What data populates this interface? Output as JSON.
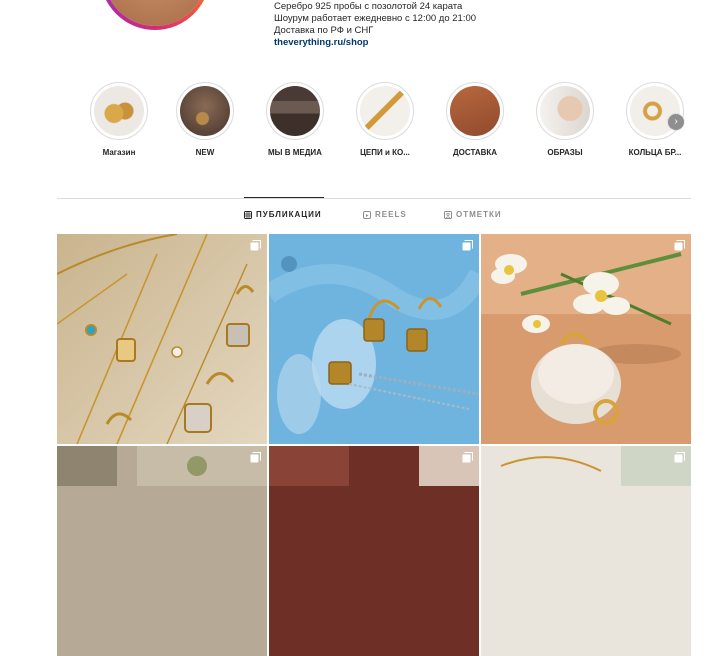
{
  "profile": {
    "bio_lines": [
      "Серебро 925 пробы с позолотой 24 карата",
      "Шоурум работает ежедневно с 12:00 до 21:00",
      "Доставка по РФ и СНГ"
    ],
    "link": "theverything.ru/shop"
  },
  "highlights": [
    {
      "label": "Магазин",
      "icon": "gold-earrings-thumbnail"
    },
    {
      "label": "NEW",
      "icon": "earrings-portrait-thumbnail"
    },
    {
      "label": "МЫ В МЕДИА",
      "icon": "media-story-thumbnail"
    },
    {
      "label": "ЦЕПИ и КО...",
      "icon": "gold-chain-thumbnail"
    },
    {
      "label": "ДОСТАВКА",
      "icon": "package-box-thumbnail"
    },
    {
      "label": "ОБРАЗЫ",
      "icon": "model-look-thumbnail"
    },
    {
      "label": "КОЛЬЦА БР...",
      "icon": "gold-ring-thumbnail"
    }
  ],
  "tabs": [
    {
      "label": "ПУБЛИКАЦИИ",
      "icon": "grid-icon",
      "active": true
    },
    {
      "label": "REELS",
      "icon": "reels-icon",
      "active": false
    },
    {
      "label": "ОТМЕТКИ",
      "icon": "tagged-icon",
      "active": false
    }
  ],
  "posts": [
    {
      "icon": "gold-necklaces-on-sand-photo",
      "multi": true
    },
    {
      "icon": "gold-earrings-on-blue-photo",
      "multi": true
    },
    {
      "icon": "flowers-and-gold-rings-photo",
      "multi": true
    },
    {
      "icon": "jewelry-on-linen-photo",
      "multi": true
    },
    {
      "icon": "jewelry-on-brown-fabric-photo",
      "multi": true
    },
    {
      "icon": "gold-chain-on-white-photo",
      "multi": true
    }
  ]
}
